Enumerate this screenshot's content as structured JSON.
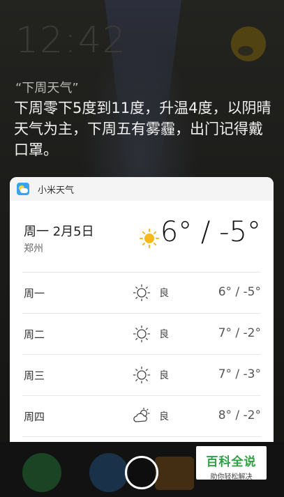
{
  "lockscreen": {
    "clock": "12:42"
  },
  "assistant": {
    "query": "“下周天气”",
    "answer": "下周零下5度到11度，升温4度，以阴晴天气为主，下周五有雾霾，出门记得戴口罩。"
  },
  "card": {
    "app_name": "小米天气",
    "today": {
      "date": "周一 2月5日",
      "city": "郑州",
      "icon": "sun-icon",
      "temp": "6° / -5°"
    },
    "forecast": [
      {
        "day": "周一",
        "icon": "sun-outline-icon",
        "aq": "良",
        "temp": "6° / -5°"
      },
      {
        "day": "周二",
        "icon": "sun-outline-icon",
        "aq": "良",
        "temp": "7° / -2°"
      },
      {
        "day": "周三",
        "icon": "sun-outline-icon",
        "aq": "良",
        "temp": "7° / -3°"
      },
      {
        "day": "周四",
        "icon": "partly-cloudy-icon",
        "aq": "良",
        "temp": "8° / -2°"
      }
    ]
  },
  "watermark": {
    "title": "百科全说",
    "subtitle": "助你轻松解决"
  },
  "colors": {
    "accent_sun": "#f7b81b",
    "badge_green": "#2fa042"
  }
}
